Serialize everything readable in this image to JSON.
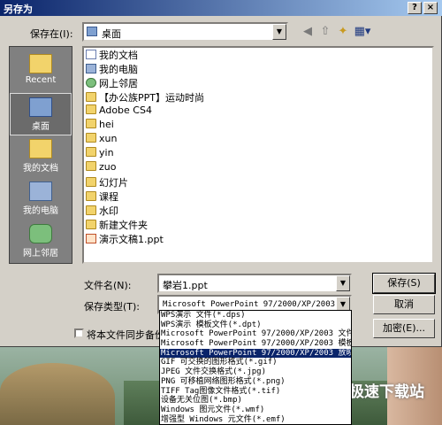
{
  "dialog": {
    "title": "另存为",
    "help_label": "?",
    "close_label": "×"
  },
  "save_in": {
    "label": "保存在(I):",
    "value": "桌面"
  },
  "places": [
    {
      "label": "Recent",
      "icon": "recent-folder-icon"
    },
    {
      "label": "桌面",
      "icon": "desktop-icon"
    },
    {
      "label": "我的文档",
      "icon": "my-documents-icon"
    },
    {
      "label": "我的电脑",
      "icon": "my-computer-icon"
    },
    {
      "label": "网上邻居",
      "icon": "network-icon"
    }
  ],
  "files": [
    {
      "name": "我的文档",
      "icon": "doc"
    },
    {
      "name": "我的电脑",
      "icon": "comp"
    },
    {
      "name": "网上邻居",
      "icon": "net"
    },
    {
      "name": "【办公族PPT】运动时尚",
      "icon": "folder"
    },
    {
      "name": "Adobe CS4",
      "icon": "folder"
    },
    {
      "name": "hei",
      "icon": "folder"
    },
    {
      "name": "xun",
      "icon": "folder"
    },
    {
      "name": "yin",
      "icon": "folder"
    },
    {
      "name": "zuo",
      "icon": "folder"
    },
    {
      "name": "幻灯片",
      "icon": "folder"
    },
    {
      "name": "课程",
      "icon": "folder"
    },
    {
      "name": "水印",
      "icon": "folder"
    },
    {
      "name": "新建文件夹",
      "icon": "folder"
    },
    {
      "name": "演示文稿1.ppt",
      "icon": "ppt"
    }
  ],
  "filename": {
    "label": "文件名(N):",
    "value": "攀岩1.ppt"
  },
  "filetype": {
    "label": "保存类型(T):",
    "value": "Microsoft PowerPoint 97/2000/XP/2003"
  },
  "buttons": {
    "save": "保存(S)",
    "cancel": "取消",
    "encrypt": "加密(E)..."
  },
  "backup_checkbox": {
    "label": "将本文件同步备份"
  },
  "filetype_options": [
    "WPS演示 文件(*.dps)",
    "WPS演示 模板文件(*.dpt)",
    "Microsoft PowerPoint 97/2000/XP/2003 文件",
    "Microsoft PowerPoint 97/2000/XP/2003 模板",
    "Microsoft PowerPoint 97/2000/XP/2003 放映",
    "GIF 可交换的图形格式(*.gif)",
    "JPEG 文件交换格式(*.jpg)",
    "PNG 可移植网络图形格式(*.png)",
    "TIFF Tag图像文件格式(*.tif)",
    "设备无关位图(*.bmp)",
    "Windows 图元文件(*.wmf)",
    "增强型 Windows 元文件(*.emf)"
  ],
  "selected_option_index": 4,
  "watermark": "极速下载站"
}
